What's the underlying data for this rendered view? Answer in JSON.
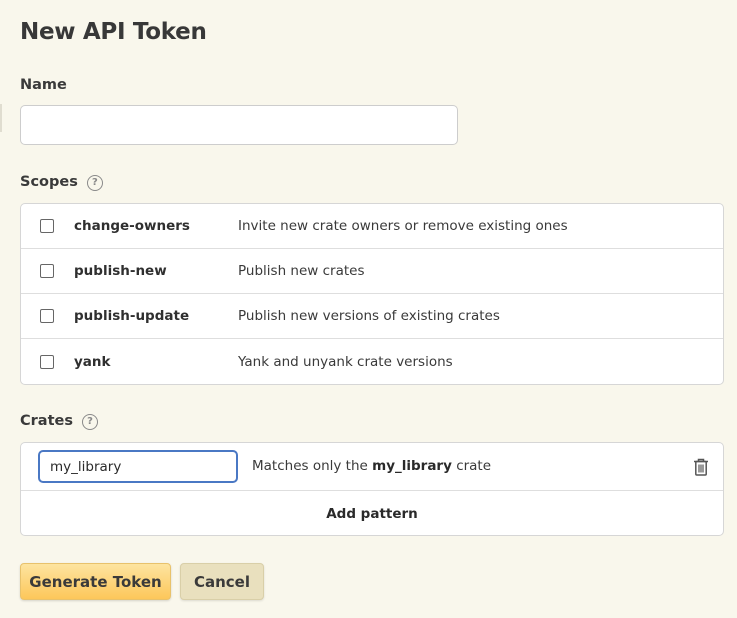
{
  "page": {
    "title": "New API Token"
  },
  "name_section": {
    "label": "Name",
    "value": "",
    "placeholder": ""
  },
  "scopes_section": {
    "label": "Scopes",
    "help": "?",
    "items": [
      {
        "name": "change-owners",
        "description": "Invite new crate owners or remove existing ones",
        "checked": false
      },
      {
        "name": "publish-new",
        "description": "Publish new crates",
        "checked": false
      },
      {
        "name": "publish-update",
        "description": "Publish new versions of existing crates",
        "checked": false
      },
      {
        "name": "yank",
        "description": "Yank and unyank crate versions",
        "checked": false
      }
    ]
  },
  "crates_section": {
    "label": "Crates",
    "help": "?",
    "patterns": [
      {
        "value": "my_library",
        "desc_prefix": "Matches only the",
        "desc_crate": "my_library",
        "desc_suffix": "crate"
      }
    ],
    "add_pattern_label": "Add pattern",
    "delete_icon": "trash-icon"
  },
  "actions": {
    "generate_label": "Generate Token",
    "cancel_label": "Cancel"
  },
  "colors": {
    "background": "#f9f7ec",
    "primary_button": "#fdc75a",
    "secondary_button": "#e9e0be",
    "focus_border": "#4a78c4"
  }
}
